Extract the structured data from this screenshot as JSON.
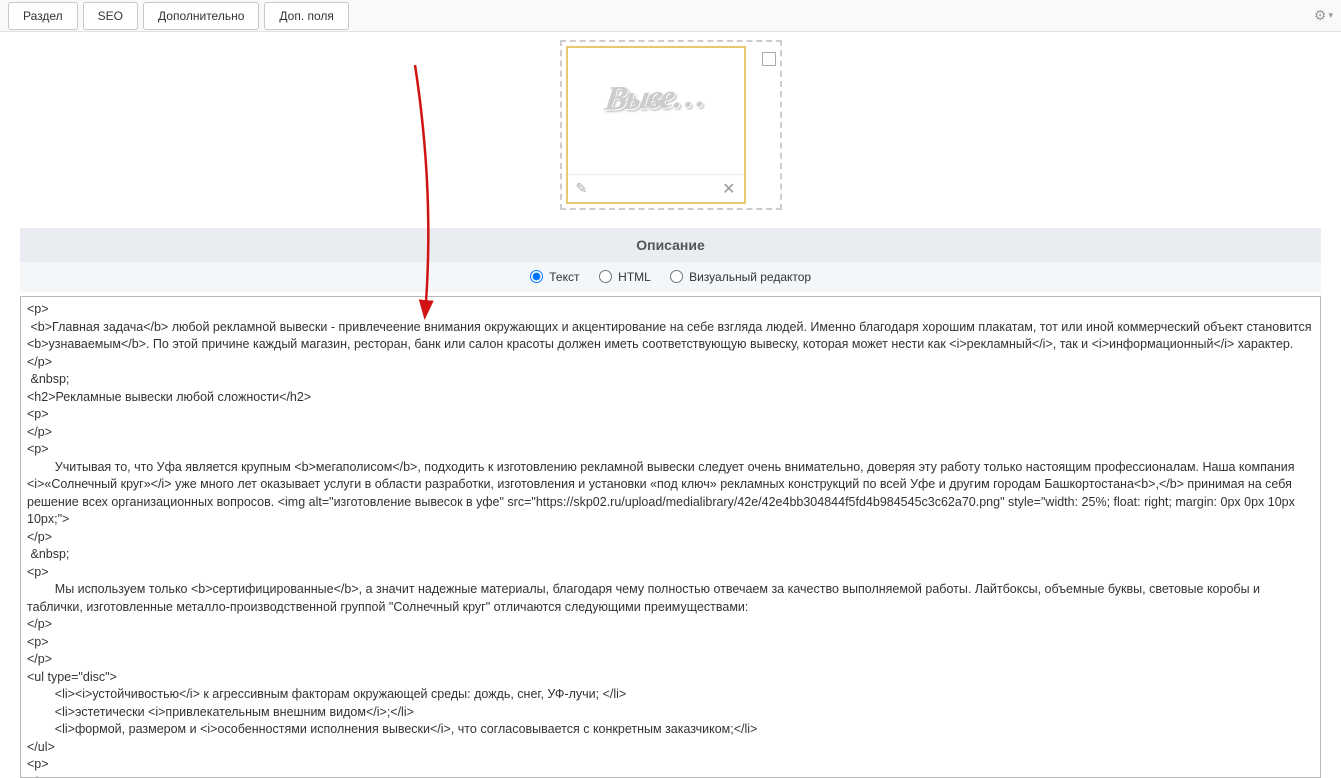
{
  "tabs": {
    "section": "Раздел",
    "seo": "SEO",
    "extra": "Дополнительно",
    "fields": "Доп. поля"
  },
  "image_text": "Выве…",
  "section_title": "Описание",
  "radios": {
    "text": "Текст",
    "html": "HTML",
    "visual": "Визуальный редактор"
  },
  "textarea_content": "<p>\n <b>Главная задача</b> любой рекламной вывески - привлечеение внимания окружающих и акцентирование на себе взгляда людей. Именно благодаря хорошим плакатам, тот или иной коммерческий объект становится <b>узнаваемым</b>. По этой причине каждый магазин, ресторан, банк или салон красоты должен иметь соответствующую вывеску, которая может нести как <i>рекламный</i>, так и <i>информационный</i> характер.\n</p>\n &nbsp;\n<h2>Рекламные вывески любой сложности</h2>\n<p>\n</p>\n<p>\n\tУчитывая то, что Уфа является крупным <b>мегаполисом</b>, подходить к изготовлению рекламной вывески следует очень внимательно, доверяя эту работу только настоящим профессионалам. Наша компания <i>«Солнечный круг»</i> уже много лет оказывает услуги в области разработки, изготовления и установки «под ключ» рекламных конструкций по всей Уфе и другим городам Башкортостана<b>,</b> принимая на себя решение всех организационных вопросов. <img alt=\"изготовление вывесок в уфе\" src=\"https://skp02.ru/upload/medialibrary/42e/42e4bb304844f5fd4b984545c3c62a70.png\" style=\"width: 25%; float: right; margin: 0px 0px 10px 10px;\">\n</p>\n &nbsp;\n<p>\n\tМы используем только <b>сертифицированные</b>, а значит надежные материалы, благодаря чему полностью отвечаем за качество выполняемой работы. Лайтбоксы, объемные буквы, световые коробы и таблички, изготовленные металло-производственной группой \"Солнечный круг\" отличаются следующими преимуществами:\n</p>\n<p>\n</p>\n<ul type=\"disc\">\n\t<li><i>устойчивостью</i> к агрессивным факторам окружающей среды: дождь, снег, УФ-лучи; </li>\n\t<li>эстетически <i>привлекательным внешним видом</i>;</li>\n\t<li>формой, размером и <i>особенностями исполнения вывески</i>, что согласовывается с конкретным заказчиком;</li>\n</ul>\n<p>\n</p>\n<p>\n"
}
